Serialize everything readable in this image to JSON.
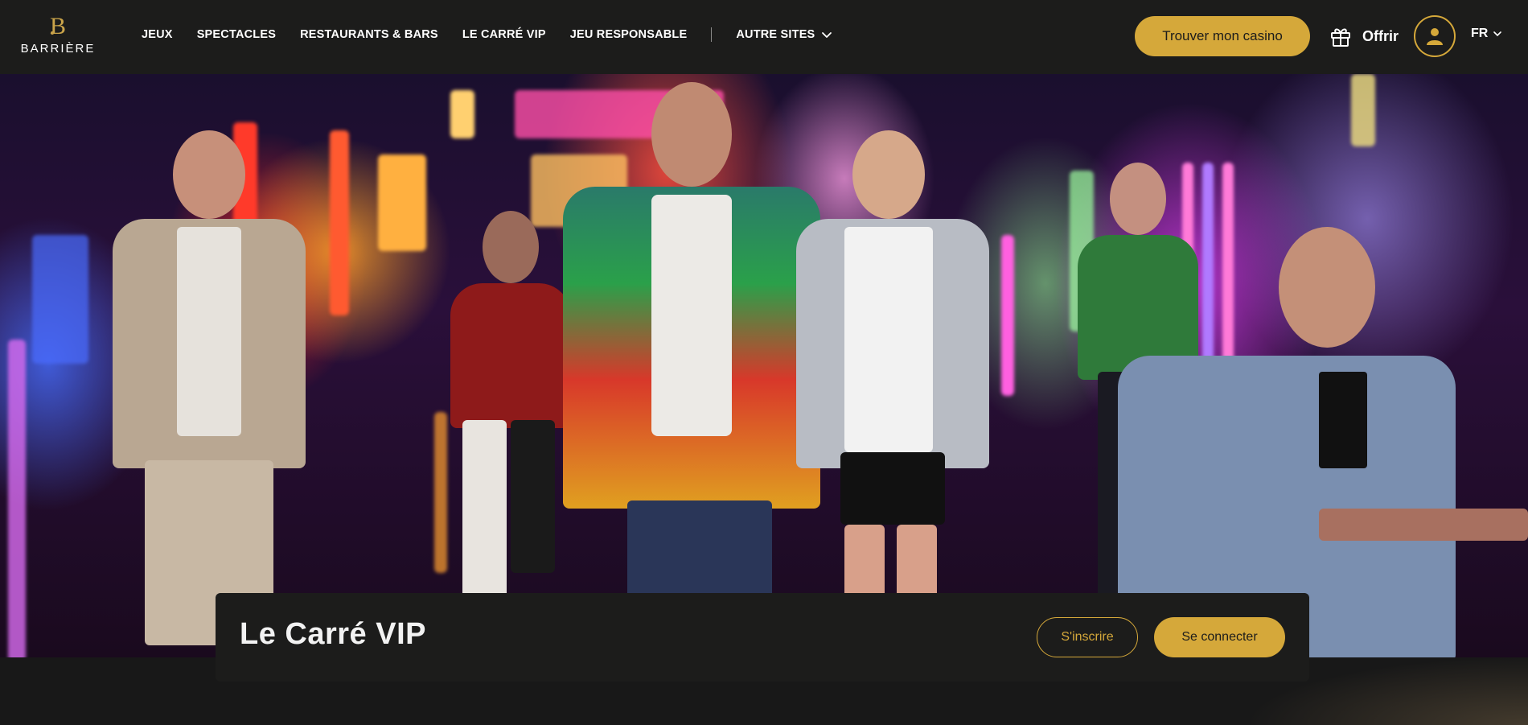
{
  "header": {
    "logo_text": "BARRIÈRE",
    "nav": [
      {
        "label": "JEUX"
      },
      {
        "label": "SPECTACLES"
      },
      {
        "label": "RESTAURANTS & BARS"
      },
      {
        "label": "LE CARRÉ VIP"
      },
      {
        "label": "JEU RESPONSABLE"
      }
    ],
    "other_sites_label": "AUTRE SITES",
    "find_casino_label": "Trouver mon casino",
    "offer_label": "Offrir",
    "language": "FR"
  },
  "hero": {
    "title": "Le Carré VIP",
    "signup_label": "S'inscrire",
    "login_label": "Se connecter"
  },
  "colors": {
    "accent": "#d5a83a",
    "header_bg": "#1c1c1b",
    "page_bg": "#181818"
  },
  "icons": [
    "logo-b-mark",
    "chevron-down-icon",
    "gift-icon",
    "user-icon"
  ]
}
